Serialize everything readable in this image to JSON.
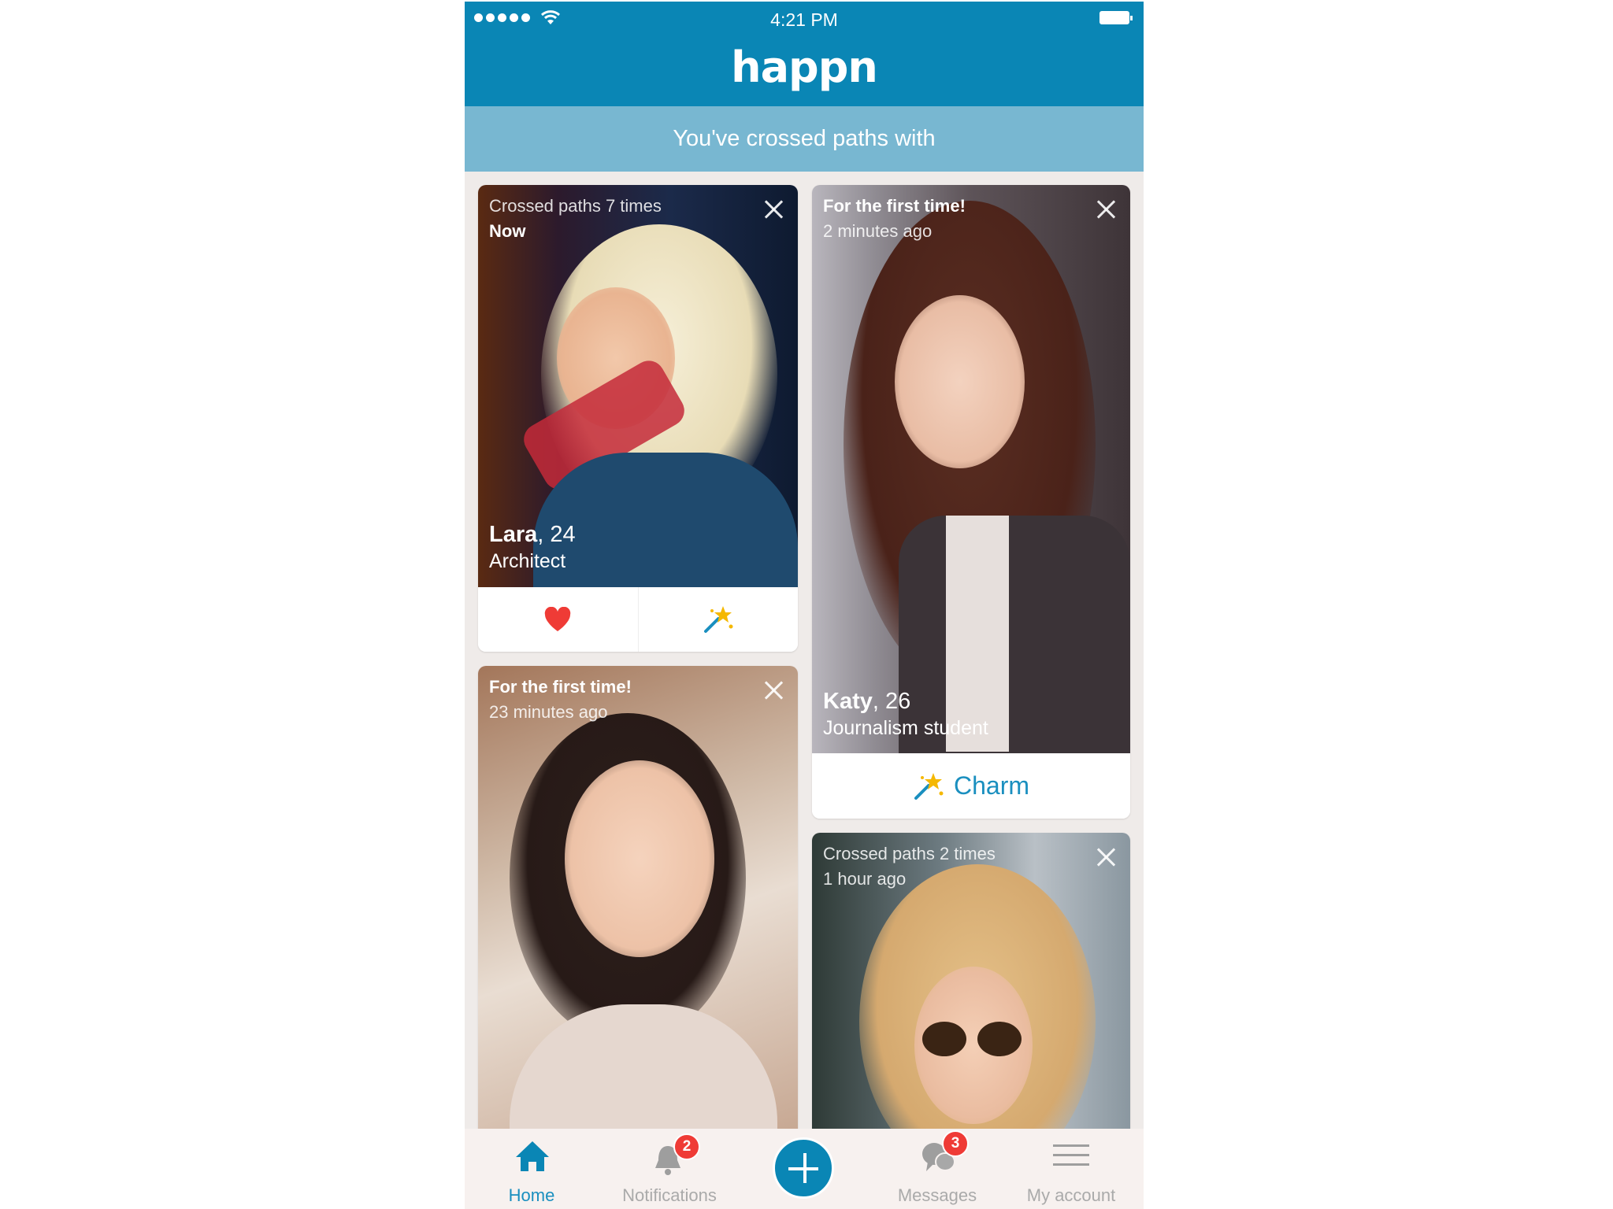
{
  "status_bar": {
    "time": "4:21 PM",
    "signal_icon": "signal-dots-icon",
    "wifi_icon": "wifi-icon",
    "battery_icon": "battery-icon"
  },
  "header": {
    "logo": "happn"
  },
  "banner": {
    "text": "You've crossed paths with"
  },
  "cards": [
    {
      "meta_line1": "Crossed paths 7 times",
      "meta_line2": "Now",
      "name": "Lara",
      "age": ", 24",
      "occupation": "Architect",
      "actions": {
        "like_icon": "heart-icon",
        "charm_icon": "magic-wand-icon"
      }
    },
    {
      "meta_line1": "For the first time!",
      "meta_line2": "2 minutes ago",
      "name": "Katy",
      "age": ", 26",
      "occupation": "Journalism student",
      "actions": {
        "charm_icon": "magic-wand-icon",
        "charm_label": "Charm"
      }
    },
    {
      "meta_line1": "For the first time!",
      "meta_line2": "23 minutes ago"
    },
    {
      "meta_line1": "Crossed paths 2 times",
      "meta_line2": "1 hour ago"
    }
  ],
  "tabbar": {
    "items": [
      {
        "label": "Home",
        "icon": "home-icon",
        "active": true
      },
      {
        "label": "Notifications",
        "icon": "bell-icon",
        "badge": "2"
      },
      {
        "label": "",
        "icon": "plus-icon"
      },
      {
        "label": "Messages",
        "icon": "chat-bubbles-icon",
        "badge": "3"
      },
      {
        "label": "My account",
        "icon": "hamburger-menu-icon"
      }
    ]
  },
  "colors": {
    "brand": "#0a86b5",
    "banner": "#78b7d1",
    "badge": "#ef3b36",
    "heart": "#ef3b36",
    "charm_star": "#f5b800",
    "charm_text": "#1a8fbf"
  }
}
